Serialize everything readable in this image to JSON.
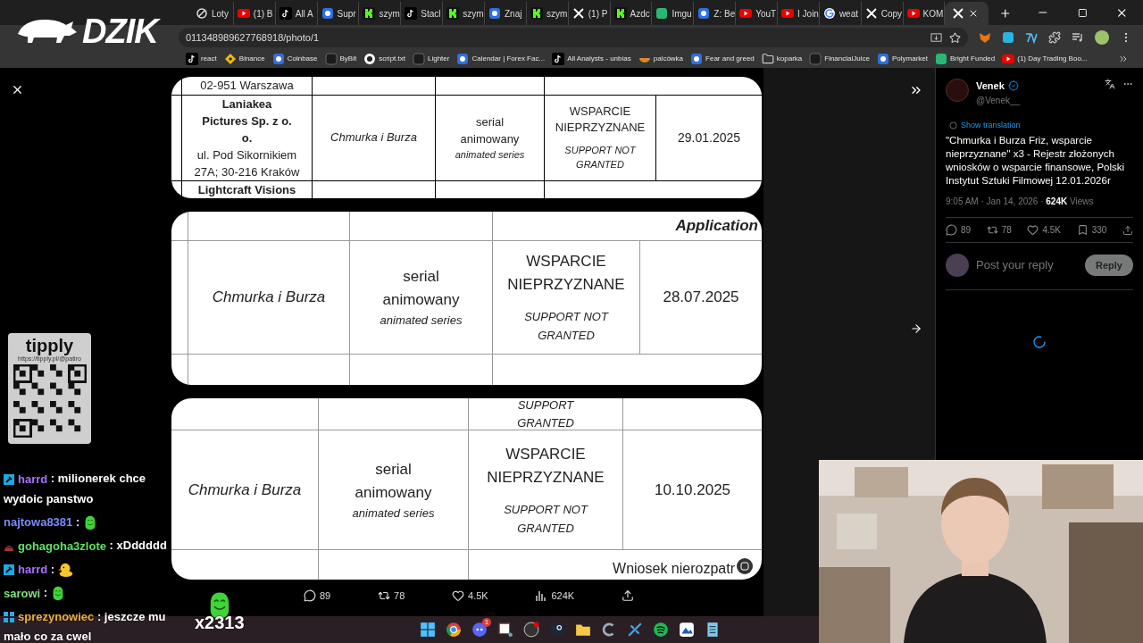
{
  "stream_logo": "DZIK",
  "browser": {
    "tabs": [
      {
        "label": "Loty",
        "selected": false
      },
      {
        "label": "(1) B",
        "selected": false
      },
      {
        "label": "All A",
        "selected": false
      },
      {
        "label": "Supr",
        "selected": false
      },
      {
        "label": "szym",
        "selected": false
      },
      {
        "label": "Stacl",
        "selected": false
      },
      {
        "label": "szym",
        "selected": false
      },
      {
        "label": "Znaj",
        "selected": false
      },
      {
        "label": "szym",
        "selected": false
      },
      {
        "label": "(1) P",
        "selected": false
      },
      {
        "label": "Azdc",
        "selected": false
      },
      {
        "label": "Imgu",
        "selected": false
      },
      {
        "label": "Z: Be",
        "selected": false
      },
      {
        "label": "YouT",
        "selected": false
      },
      {
        "label": "I Join",
        "selected": false
      },
      {
        "label": "weat",
        "selected": false
      },
      {
        "label": "Copy",
        "selected": false
      },
      {
        "label": "KOM",
        "selected": false
      },
      {
        "selected": true
      }
    ],
    "address": "011348989627768918/photo/1",
    "bookmarks": [
      "react",
      "Binance",
      "Coinbase",
      "ByBit",
      "script.txt",
      "Lighter",
      "Calendar | Forex Fac...",
      "All Analysts - unbias",
      "palcówka",
      "Fear and greed",
      "koparka",
      "FinancialJuice",
      "Polymarket",
      "Bright Funded",
      "(1) Day Trading Boo..."
    ]
  },
  "photos": [
    {
      "kind": "company_row",
      "top_text": "02-951 Warszawa",
      "company": "Laniakea Pictures Sp. z o. o.",
      "company_address": "ul. Pod Sikornikiem 27A; 30-216 Kraków",
      "title": "Chmurka i Burza",
      "type": "serial animowany",
      "type_en": "animated series",
      "status": "WSPARCIE NIEPRZYZNANE",
      "status_en": "SUPPORT NOT GRANTED",
      "date": "29.01.2025",
      "bottom_text": "Lightcraft Visions"
    },
    {
      "kind": "middle_row",
      "top_text": "Application",
      "title": "Chmurka i Burza",
      "type": "serial animowany",
      "type_en": "animated series",
      "status": "WSPARCIE NIEPRZYZNANE",
      "status_en": "SUPPORT NOT GRANTED",
      "date": "28.07.2025"
    },
    {
      "kind": "last_row",
      "top_text": "SUPPORT GRANTED",
      "title": "Chmurka i Burza",
      "type": "serial animowany",
      "type_en": "animated series",
      "status": "WSPARCIE NIEPRZYZNANE",
      "status_en": "SUPPORT NOT GRANTED",
      "date": "10.10.2025",
      "bottom_text": "Wniosek nierozpatr"
    }
  ],
  "photo_actions": {
    "replies": "89",
    "reposts": "78",
    "likes": "4.5K",
    "views": "624K"
  },
  "tweet": {
    "name": "Venek",
    "handle": "@Venek__",
    "show_translation": "Show translation",
    "text": "\"Chmurka i Burza Friz, wsparcie nieprzyznane\" x3 - Rejestr złożonych wniosków o wsparcie finansowe, Polski Instytut Sztuki Filmowej 12.01.2026r",
    "time": "9:05 AM · Jan 14, 2026 · ",
    "views_count": "624K",
    "views_label": " Views",
    "replies": "89",
    "reposts": "78",
    "likes": "4.5K",
    "bookmarks": "330",
    "reply_placeholder": "Post your reply",
    "reply_button": "Reply"
  },
  "tip_card": {
    "brand": "tipply",
    "url": "https://tipply.pl/@patiro"
  },
  "chat": [
    {
      "user": "harrd",
      "color": "#a970ff",
      "text": ": milionerek chce wydoic panstwo"
    },
    {
      "user": "najtowa8381",
      "color": "#7a8cff",
      "text": ":"
    },
    {
      "user": "gohagoha3zlote",
      "color": "#5fe35f",
      "text": ": xDddddd"
    },
    {
      "user": "harrd",
      "color": "#a970ff",
      "text": ":"
    },
    {
      "user": "sarowi",
      "color": "#7fe07f",
      "text": ":"
    },
    {
      "user": "sprezynowiec",
      "color": "#f0b040",
      "text": ": jeszcze mu mało co za cwel"
    }
  ],
  "sub_counter": "x2313",
  "taskbar": {
    "discord_badge": "1"
  }
}
